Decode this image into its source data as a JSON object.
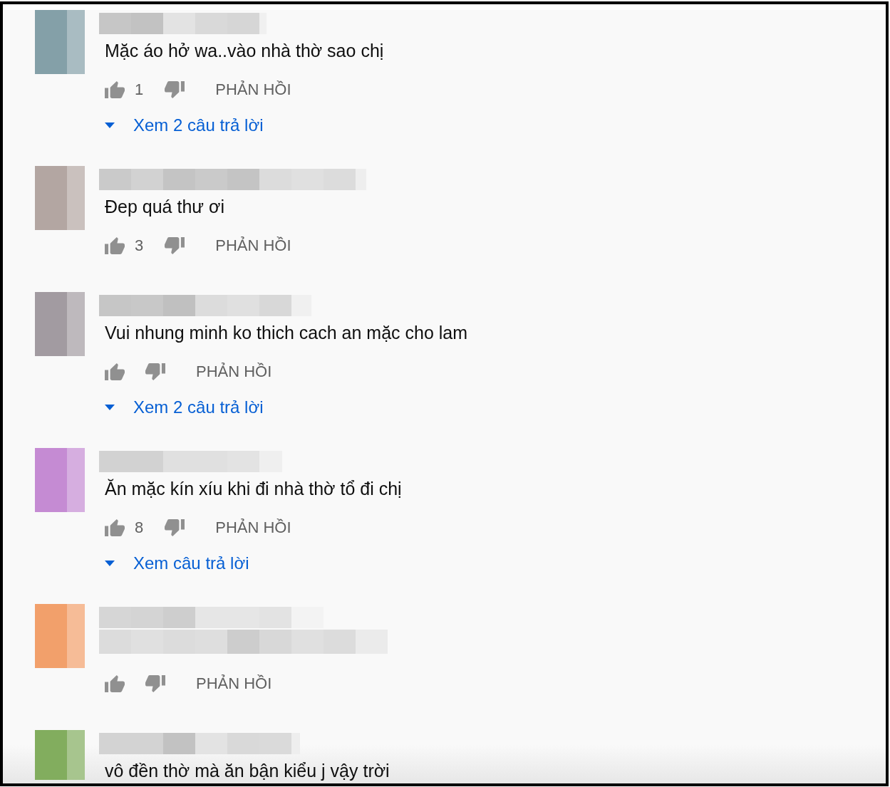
{
  "comments": [
    {
      "avatar": {
        "color": "#84a0a8"
      },
      "text": "Mặc áo hở wa..vào nhà thờ sao chị",
      "like_count": "1",
      "reply_label": "PHẢN HỒI",
      "view_replies": "Xem 2 câu trả lời"
    },
    {
      "avatar": {
        "color": "#b3a6a2"
      },
      "text": "Đep quá thư ơi",
      "like_count": "3",
      "reply_label": "PHẢN HỒI"
    },
    {
      "avatar": {
        "color": "#a29ba1"
      },
      "text": "Vui nhung minh ko thich cach an mặc cho lam",
      "reply_label": "PHẢN HỒI",
      "view_replies": "Xem 2 câu trả lời"
    },
    {
      "avatar": {
        "color": "#c58bd3"
      },
      "text": "Ăn mặc kín xíu khi đi nhà thờ tổ đi chị",
      "like_count": "8",
      "reply_label": "PHẢN HỒI",
      "view_replies": "Xem câu trả lời"
    },
    {
      "avatar": {
        "color": "#f2a06b"
      },
      "reply_label": "PHẢN HỒI"
    },
    {
      "avatar": {
        "color": "#82ad5e"
      },
      "text": "vô đền thờ mà ăn bận kiểu j vậy trời"
    }
  ]
}
